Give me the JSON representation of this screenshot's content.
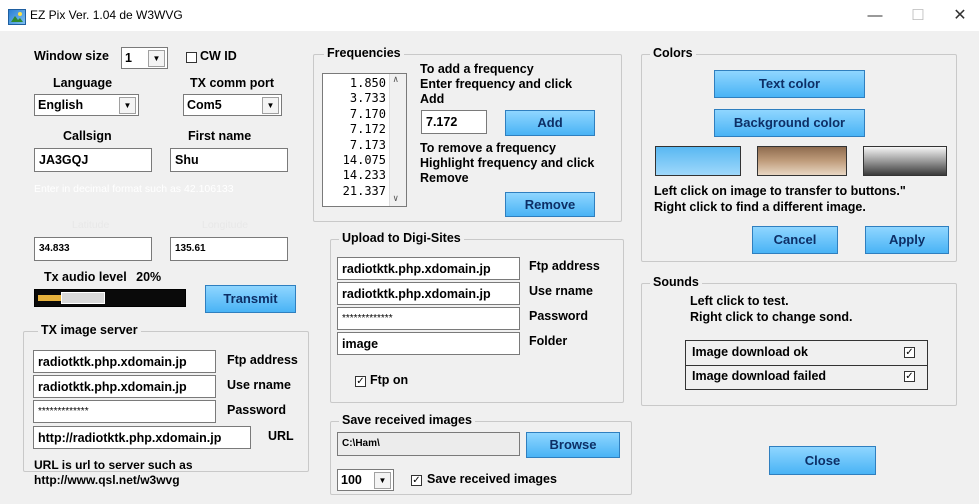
{
  "window": {
    "title": "EZ Pix   Ver. 1.04 de W3WVG",
    "minimize": "—",
    "maximize": "☐",
    "close": "✕"
  },
  "main": {
    "window_size_label": "Window size",
    "window_size_value": "1",
    "cw_id_label": "CW ID",
    "language_label": "Language",
    "language_value": "English",
    "tx_comm_port_label": "TX comm port",
    "tx_comm_port_value": "Com5",
    "callsign_label": "Callsign",
    "callsign_value": "JA3GQJ",
    "first_name_label": "First name",
    "first_name_value": "Shu",
    "decimal_hint": "Enter in decimal format such as 42.106133",
    "latitude_label": "Latitude",
    "latitude_value": "34.833",
    "longitude_label": "Longitude",
    "longitude_value": "135.61",
    "tx_audio_level_label": "Tx audio level",
    "tx_audio_level_value": "20%",
    "tx_audio_level_fraction": 0.2,
    "transmit_label": "Transmit"
  },
  "tx_image_server": {
    "title": "TX image server",
    "ftp_address_value": "radiotktk.php.xdomain.jp",
    "ftp_address_label": "Ftp address",
    "username_value": "radiotktk.php.xdomain.jp",
    "username_label": "Use rname",
    "password_value": "*************",
    "password_label": "Password",
    "url_value": "http://radiotktk.php.xdomain.jp",
    "url_label": "URL",
    "note_line1": "URL is url to server such as",
    "note_line2": "http://www.qsl.net/w3wvg"
  },
  "frequencies": {
    "title": "Frequencies",
    "items": [
      "1.850",
      "3.733",
      "7.170",
      "7.172",
      "7.173",
      "14.075",
      "14.233",
      "21.337"
    ],
    "add_instructions_1": "To add a frequency",
    "add_instructions_2": "Enter frequency and click",
    "add_instructions_3": "Add",
    "entry_value": "7.172",
    "add_label": "Add",
    "remove_instructions_1": "To remove a frequency",
    "remove_instructions_2": "Highlight frequency and click",
    "remove_instructions_3": "Remove",
    "remove_label": "Remove"
  },
  "upload": {
    "title": "Upload to Digi-Sites",
    "ftp_address_value": "radiotktk.php.xdomain.jp",
    "ftp_address_label": "Ftp address",
    "username_value": "radiotktk.php.xdomain.jp",
    "username_label": "Use rname",
    "password_value": "*************",
    "password_label": "Password",
    "folder_value": "image",
    "folder_label": "Folder",
    "ftp_on_label": "Ftp on"
  },
  "save_images": {
    "title": "Save received images",
    "path_value": "C:\\Ham\\",
    "browse_label": "Browse",
    "count_value": "100",
    "checkbox_label": "Save received images"
  },
  "colors": {
    "title": "Colors",
    "text_color_label": "Text color",
    "background_color_label": "Background color",
    "instructions_1": "Left click on image to transfer to buttons.\"",
    "instructions_2": "Right click to find a different image.",
    "cancel_label": "Cancel",
    "apply_label": "Apply",
    "swatch_1": "#59b8f2",
    "swatch_2": "#c09d7c",
    "swatch_3": "#9a9a9a"
  },
  "sounds": {
    "title": "Sounds",
    "instructions_1": "Left click to test.",
    "instructions_2": "Right click to change sond.",
    "items": [
      {
        "label": "Image download ok",
        "checked": true
      },
      {
        "label": "Image download failed",
        "checked": true
      }
    ]
  },
  "close_label": "Close",
  "check_mark": "✓",
  "accent_color": "#49b3f5"
}
